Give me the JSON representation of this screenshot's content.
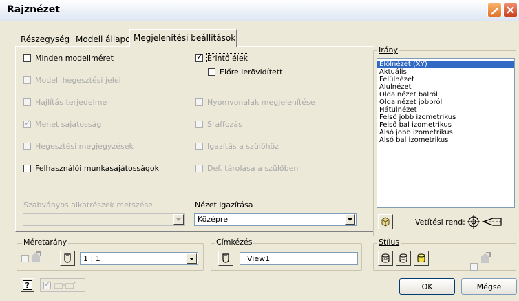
{
  "window": {
    "title": "Rajznézet"
  },
  "tabs": [
    {
      "label": "Részegység",
      "active": false
    },
    {
      "label": "Modell állapota",
      "active": false
    },
    {
      "label": "Megjelenítési beállítások",
      "active": true
    }
  ],
  "options_left": [
    {
      "label": "Minden modellméret",
      "checked": false,
      "enabled": true
    },
    {
      "label": "Modell hegesztési jelei",
      "checked": false,
      "enabled": false
    },
    {
      "label": "Hajlítás terjedelme",
      "checked": false,
      "enabled": false
    },
    {
      "label": "Menet sajátosság",
      "checked": true,
      "enabled": false
    },
    {
      "label": "Hegesztési megjegyzések",
      "checked": false,
      "enabled": false
    },
    {
      "label": "Felhasználói munkasajátosságok",
      "checked": false,
      "enabled": true
    }
  ],
  "options_right": [
    {
      "label": "Érintő élek",
      "checked": true,
      "enabled": true
    },
    {
      "label": "Előre lerövidített",
      "checked": false,
      "enabled": true
    },
    {
      "label": "Nyomvonalak megjelenítése",
      "checked": false,
      "enabled": false
    },
    {
      "label": "Sraffozás",
      "checked": false,
      "enabled": false
    },
    {
      "label": "Igazítás a szülőhöz",
      "checked": false,
      "enabled": false
    },
    {
      "label": "Def. tárolása a szülőben",
      "checked": false,
      "enabled": false
    }
  ],
  "std_parts": {
    "label": "Szabványos alkatrészek metszése",
    "value": ""
  },
  "view_align": {
    "label": "Nézet igazítása",
    "value": "Középre"
  },
  "orientation": {
    "label": "Irány",
    "items": [
      "Elölnézet (XY)",
      "Aktuális",
      "Felülnézet",
      "Alulnézet",
      "Oldalnézet balról",
      "Oldalnézet jobbról",
      "Hátulnézet",
      "Felső jobb izometrikus",
      "Felső bal izometrikus",
      "Alsó jobb izometrikus",
      "Alsó bal izometrikus"
    ],
    "selected_index": 0,
    "projection_label": "Vetítési rend:"
  },
  "scale": {
    "label": "Méretarány",
    "value": "1 : 1"
  },
  "label_group": {
    "label": "Címkézés",
    "value": "View1"
  },
  "style": {
    "label": "Stílus"
  },
  "buttons": {
    "ok": "OK",
    "cancel": "Mégse"
  },
  "colors": {
    "accent": "#316ac5",
    "window_bg": "#ece9d8",
    "disabled_text": "#a9a9a9"
  }
}
